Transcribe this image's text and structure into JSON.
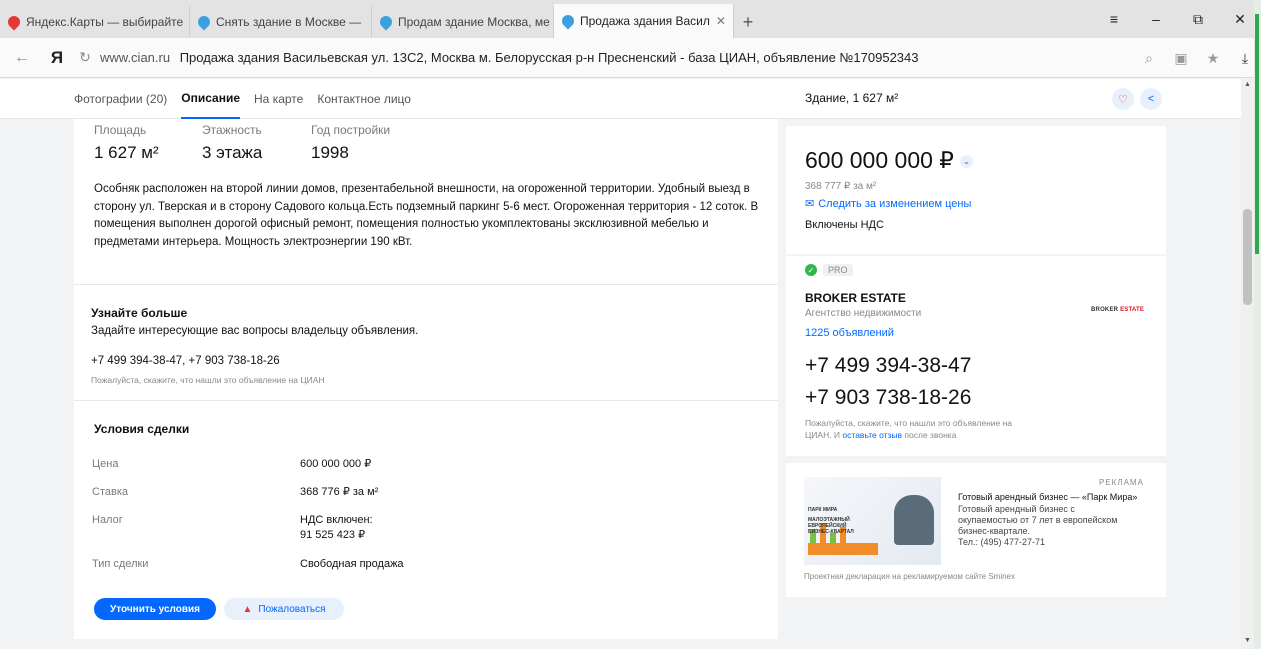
{
  "browser": {
    "tabs": [
      {
        "label": "Яндекс.Карты — выбирайте",
        "color": "#e53935",
        "active": false
      },
      {
        "label": "Снять здание в Москве — ",
        "color": "#3aa0e0",
        "active": false
      },
      {
        "label": "Продам здание Москва, ме",
        "color": "#3aa0e0",
        "active": false
      },
      {
        "label": "Продажа здания Васил",
        "color": "#3aa0e0",
        "active": true
      }
    ],
    "new_tab": "+",
    "controls": {
      "menu": "≡",
      "minimize": "–",
      "restore": "⧉",
      "close": "✕"
    },
    "address": {
      "back": "←",
      "logo": "Я",
      "reload": "↻",
      "domain": "www.cian.ru",
      "title": "Продажа здания Васильевская ул. 13С2, Москва м. Белорусская р-н Пресненский - база ЦИАН, объявление №170952343"
    }
  },
  "page_nav": {
    "links": [
      "Фотографии (20)",
      "Описание",
      "На карте",
      "Контактное лицо"
    ],
    "active_index": 1,
    "summary": "Здание, 1 627 м²"
  },
  "stats": [
    {
      "label": "Площадь",
      "value": "1 627 м²"
    },
    {
      "label": "Этажность",
      "value": "3 этажа"
    },
    {
      "label": "Год постройки",
      "value": "1998"
    }
  ],
  "description": "Особняк расположен на второй линии домов, презентабельной внешности, на огороженной территории. Удобный выезд в сторону ул. Тверская и в сторону Садового кольца.Есть подземный паркинг 5-6 мест. Огороженная территория - 12 соток. В помещения выполнен дорогой офисный ремонт, помещения полностью укомплектованы эксклюзивной мебелью и предметами интерьера. Мощность электроэнергии 190 кВт.",
  "learn_more": {
    "title": "Узнайте больше",
    "subtitle": "Задайте интересующие вас вопросы владельцу объявления.",
    "phones": "+7 499 394-38-47, +7 903 738-18-26",
    "hint": "Пожалуйста, скажите, что нашли это объявление на ЦИАН"
  },
  "deal": {
    "title": "Условия сделки",
    "rows": [
      {
        "label": "Цена",
        "value": "600 000 000 ₽"
      },
      {
        "label": "Ставка",
        "value": "368 776 ₽ за м²"
      },
      {
        "label": "Налог",
        "value": "НДС включен:",
        "value2": "91 525 423 ₽"
      },
      {
        "label": "Тип сделки",
        "value": "Свободная продажа"
      }
    ],
    "primary_button": "Уточнить условия",
    "secondary_button": "Пожаловаться"
  },
  "price_card": {
    "price": "600 000 000 ₽",
    "per_meter": "368 777 ₽ за м²",
    "subscribe": "Следить за изменением цены",
    "vat": "Включены НДС"
  },
  "agent": {
    "badge": "PRO",
    "name": "BROKER ESTATE",
    "type": "Агентство недвижимости",
    "listings": "1225 объявлений",
    "logo_text_a": "BROKER",
    "logo_text_b": "ESTATE",
    "phone1": "+7 499 394-38-47",
    "phone2": "+7 903 738-18-26",
    "hint_a": "Пожалуйста, скажите, что нашли это объявление на",
    "hint_b": "ЦИАН. И",
    "hint_link": "оставьте отзыв",
    "hint_c": "после звонка"
  },
  "ad": {
    "label": "РЕКЛАМА",
    "title": "Готовый арендный бизнес — «Парк Мира»",
    "text1": "Готовый арендный бизнес с",
    "text2": "окупаемостью от 7 лет в европейском",
    "text3": "бизнес-квартале.",
    "phone": "Тел.: (495) 477-27-71",
    "image_logo": "ПАРК МИРА",
    "image_tagline": "МАЛОЭТАЖНЫЙ ЕВРОПЕЙСКИЙ БИЗНЕС-КВАРТАЛ",
    "footer": "Проектная декларация на рекламируемом сайте Sminex"
  },
  "colors": {
    "accent": "#0468ff",
    "success": "#2fb84a",
    "warning": "#e8343e"
  }
}
